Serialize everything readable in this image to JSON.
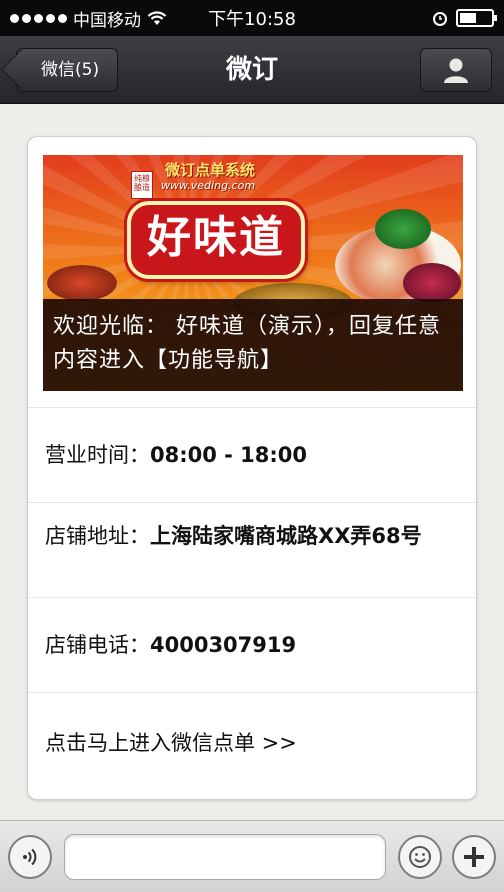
{
  "status_bar": {
    "carrier": "中国移动",
    "time": "下午10:58"
  },
  "nav": {
    "back_label": "微信(5)",
    "title": "微订"
  },
  "banner": {
    "system_label": "微订点单系统",
    "url": "www.veding.com",
    "seal_text": "纯粮酿造",
    "logo_text": "好味道",
    "caption": "欢迎光临： 好味道（演示），回复任意内容进入【功能导航】"
  },
  "info": {
    "hours_label": "营业时间：",
    "hours_value": "08:00 - 18:00",
    "address_label": "店铺地址：",
    "address_value": "上海陆家嘴商城路XX弄68号",
    "phone_label": "店铺电话：",
    "phone_value": "4000307919",
    "order_link": "点击马上进入微信点单 >>"
  },
  "input_bar": {
    "message_value": ""
  },
  "colors": {
    "nav_bg": "#2e3035",
    "banner_caption_bg": "#1e0a05",
    "logo_red": "#c8161b"
  }
}
